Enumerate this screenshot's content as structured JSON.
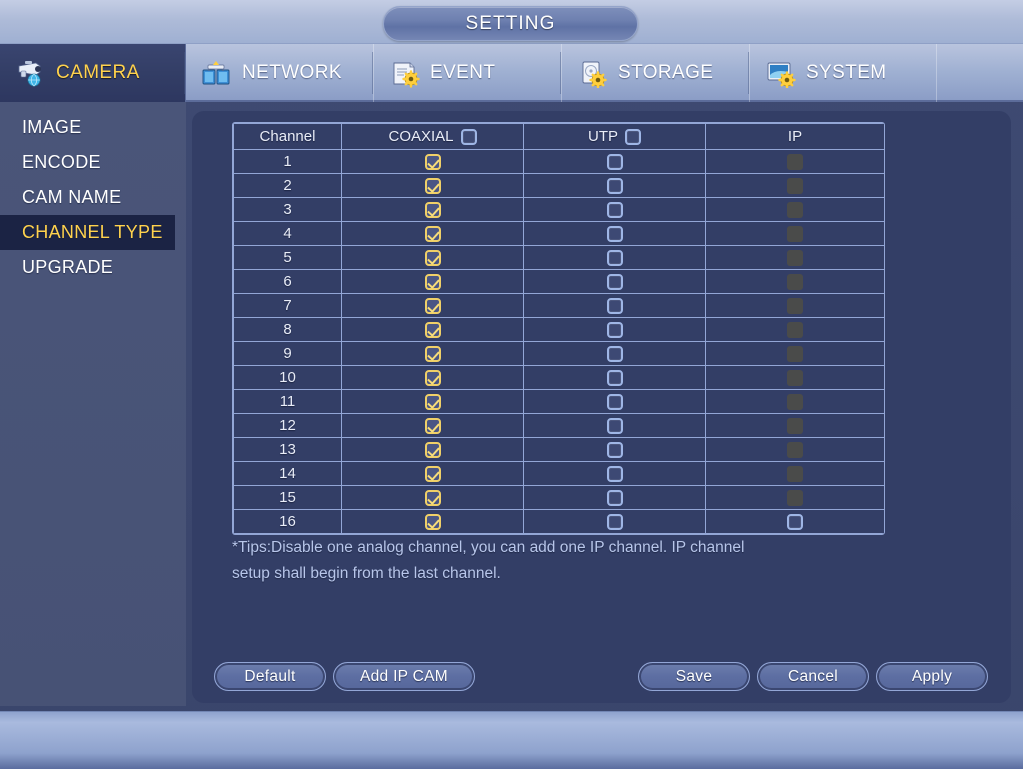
{
  "window": {
    "title": "SETTING"
  },
  "tabs": [
    {
      "label": "CAMERA",
      "icon": "camera-icon",
      "active": true
    },
    {
      "label": "NETWORK",
      "icon": "network-icon",
      "active": false
    },
    {
      "label": "EVENT",
      "icon": "event-icon",
      "active": false
    },
    {
      "label": "STORAGE",
      "icon": "storage-icon",
      "active": false
    },
    {
      "label": "SYSTEM",
      "icon": "system-icon",
      "active": false
    }
  ],
  "sidebar": {
    "items": [
      {
        "label": "IMAGE",
        "active": false
      },
      {
        "label": "ENCODE",
        "active": false
      },
      {
        "label": "CAM NAME",
        "active": false
      },
      {
        "label": "CHANNEL TYPE",
        "active": true
      },
      {
        "label": "UPGRADE",
        "active": false
      }
    ]
  },
  "table": {
    "columns": [
      {
        "label": "Channel",
        "header_checkbox": false
      },
      {
        "label": "COAXIAL",
        "header_checkbox": true,
        "header_checked": false
      },
      {
        "label": "UTP",
        "header_checkbox": true,
        "header_checked": false
      },
      {
        "label": "IP",
        "header_checkbox": false
      }
    ],
    "rows": [
      {
        "channel": "1",
        "coaxial": "checked",
        "utp": "unchecked",
        "ip": "disabled"
      },
      {
        "channel": "2",
        "coaxial": "checked",
        "utp": "unchecked",
        "ip": "disabled"
      },
      {
        "channel": "3",
        "coaxial": "checked",
        "utp": "unchecked",
        "ip": "disabled"
      },
      {
        "channel": "4",
        "coaxial": "checked",
        "utp": "unchecked",
        "ip": "disabled"
      },
      {
        "channel": "5",
        "coaxial": "checked",
        "utp": "unchecked",
        "ip": "disabled"
      },
      {
        "channel": "6",
        "coaxial": "checked",
        "utp": "unchecked",
        "ip": "disabled"
      },
      {
        "channel": "7",
        "coaxial": "checked",
        "utp": "unchecked",
        "ip": "disabled"
      },
      {
        "channel": "8",
        "coaxial": "checked",
        "utp": "unchecked",
        "ip": "disabled"
      },
      {
        "channel": "9",
        "coaxial": "checked",
        "utp": "unchecked",
        "ip": "disabled"
      },
      {
        "channel": "10",
        "coaxial": "checked",
        "utp": "unchecked",
        "ip": "disabled"
      },
      {
        "channel": "11",
        "coaxial": "checked",
        "utp": "unchecked",
        "ip": "disabled"
      },
      {
        "channel": "12",
        "coaxial": "checked",
        "utp": "unchecked",
        "ip": "disabled"
      },
      {
        "channel": "13",
        "coaxial": "checked",
        "utp": "unchecked",
        "ip": "disabled"
      },
      {
        "channel": "14",
        "coaxial": "checked",
        "utp": "unchecked",
        "ip": "disabled"
      },
      {
        "channel": "15",
        "coaxial": "checked",
        "utp": "unchecked",
        "ip": "disabled"
      },
      {
        "channel": "16",
        "coaxial": "checked",
        "utp": "unchecked",
        "ip": "unchecked"
      }
    ]
  },
  "tips": {
    "line1": "*Tips:Disable one analog channel, you can add one IP channel. IP channel",
    "line2": "setup shall begin from the last channel."
  },
  "buttons": {
    "default": "Default",
    "add_ip_cam": "Add IP CAM",
    "save": "Save",
    "cancel": "Cancel",
    "apply": "Apply"
  },
  "colors": {
    "accent_yellow": "#ffd24d",
    "panel_bg": "#333e66",
    "app_bg": "#3e4a72",
    "grid_line": "#93a6d6",
    "checked_border": "#f0d068",
    "unchecked_border": "#9fb6e6",
    "disabled_fill": "#4a4b4a"
  }
}
